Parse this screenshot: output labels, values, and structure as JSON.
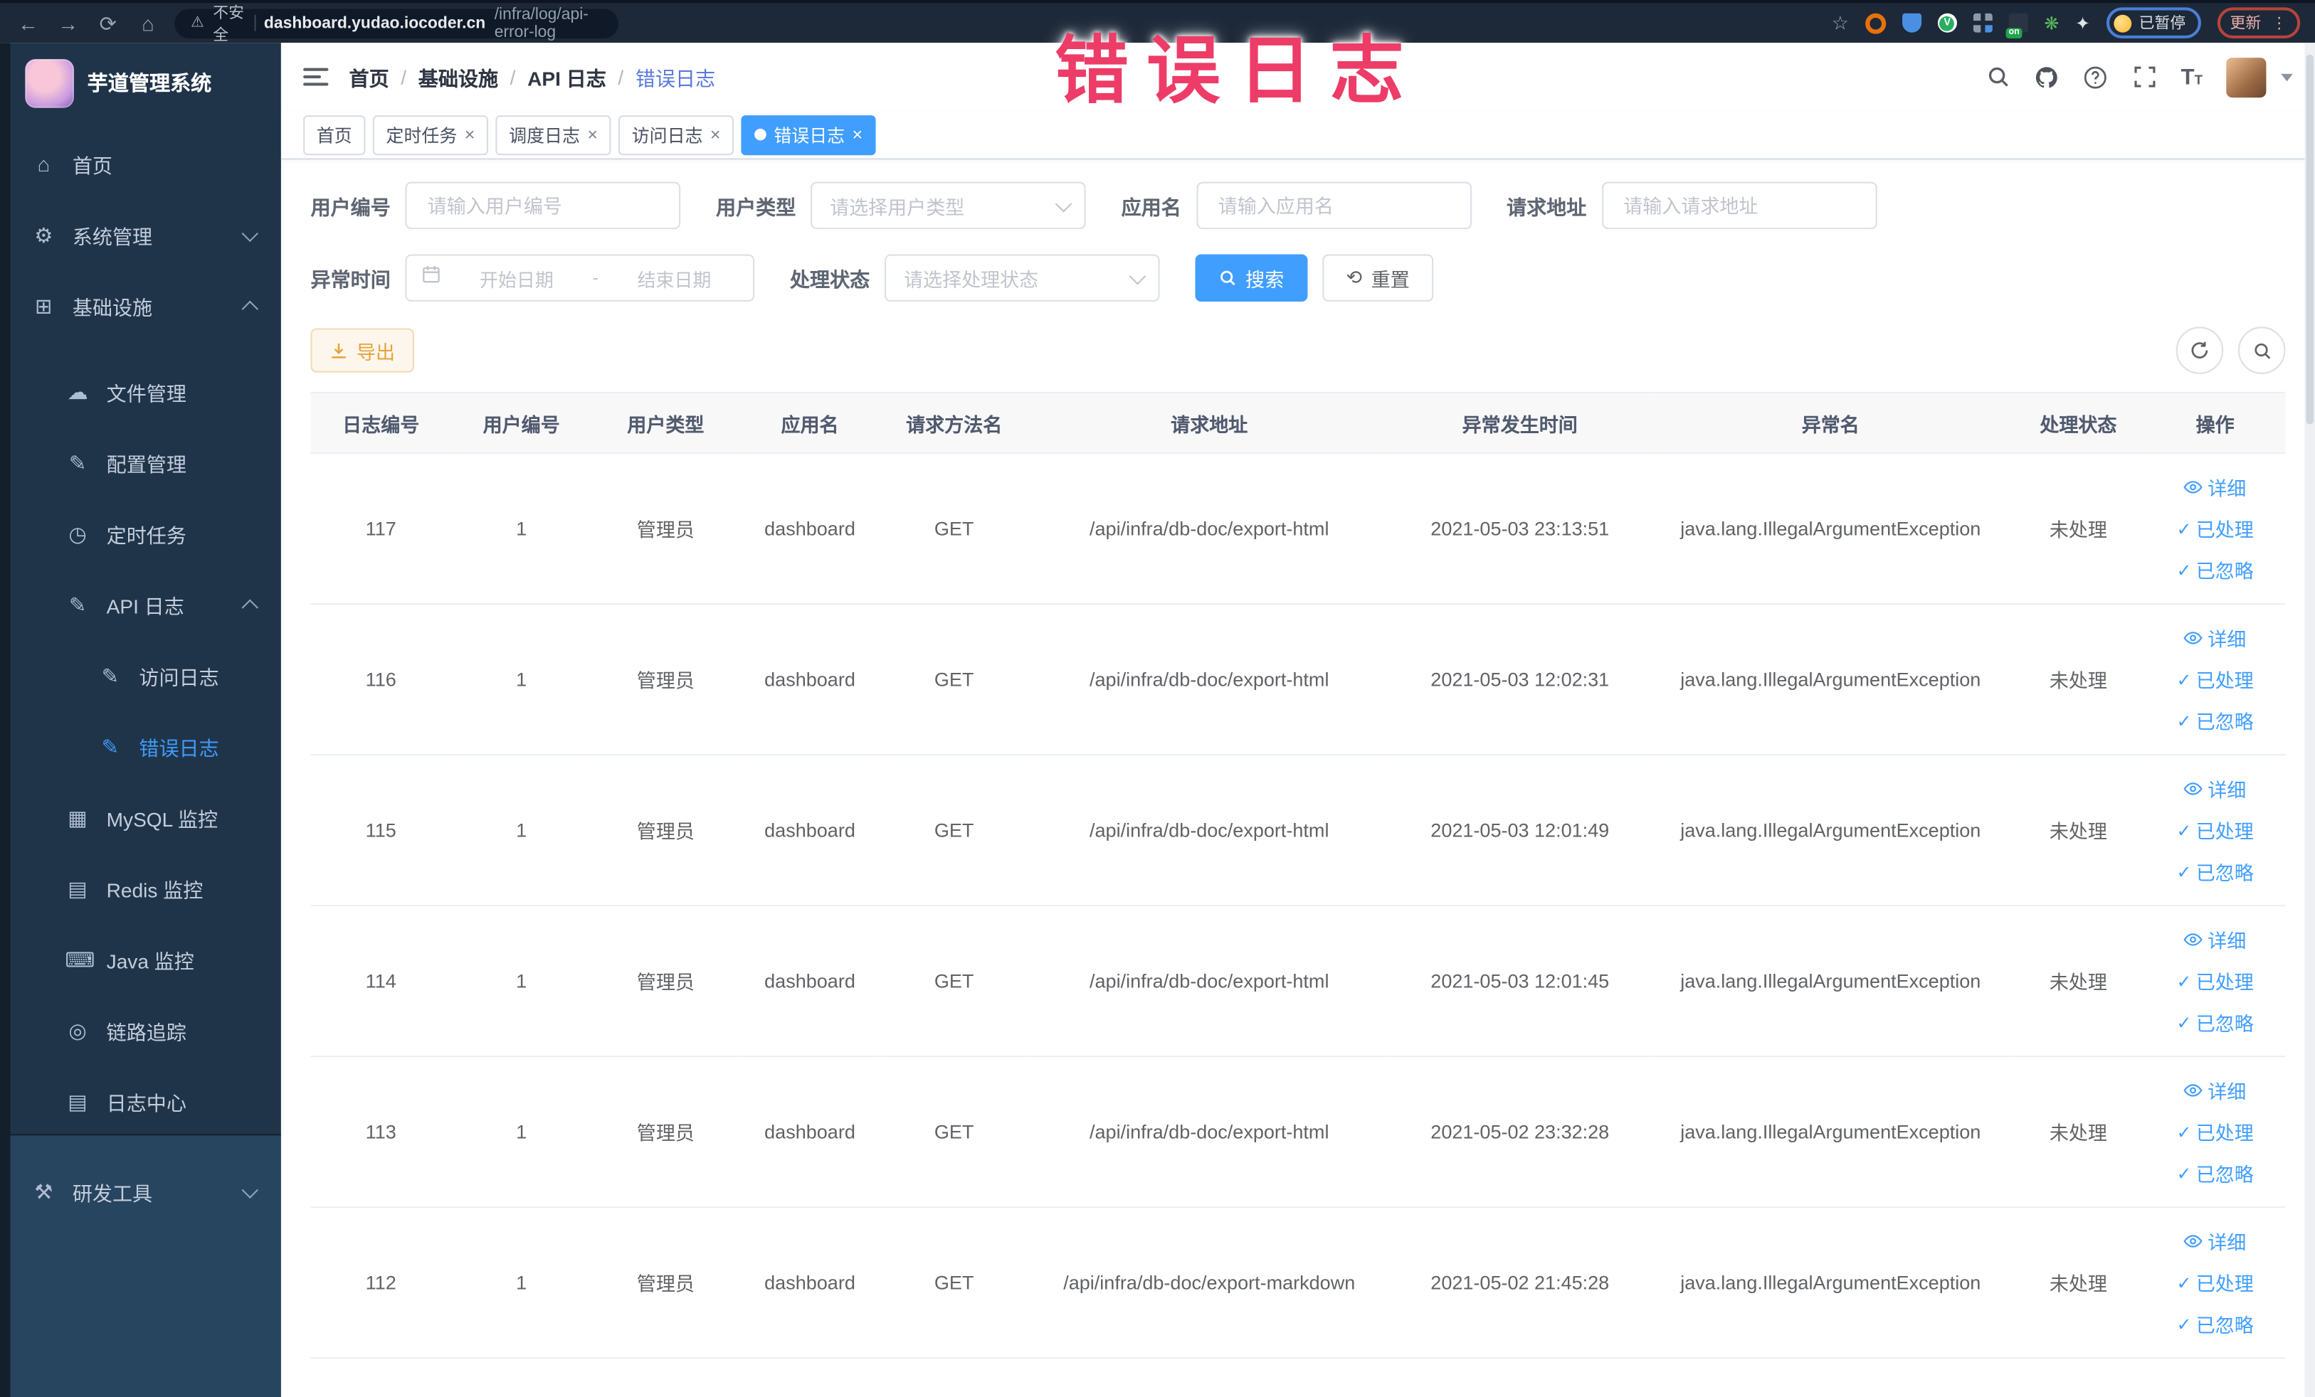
{
  "colors": {
    "accent": "#409eff",
    "warning": "#e6a23c",
    "annotation": "#ed3c68",
    "sidebar_bg": "#203449"
  },
  "icons": {
    "back": "←",
    "forward": "→",
    "reload": "⟳",
    "home": "⌂",
    "warning": "⚠",
    "star": "☆",
    "check": "✓",
    "close": "×",
    "kebab": "⋮",
    "ext_leaf": "❋",
    "ext_puzzle": "✦",
    "ext_green_v": "V",
    "reset": "⟲"
  },
  "annotation": {
    "text": "错误日志"
  },
  "browser": {
    "security_label": "不安全",
    "url_domain": "dashboard.yudao.iocoder.cn",
    "url_path": "/infra/log/api-error-log",
    "ext_on_badge": "on",
    "paused_chip": "已暂停",
    "update_button": "更新"
  },
  "sidebar": {
    "app_title": "芋道管理系统",
    "items": [
      {
        "icon": "⌂",
        "label": "首页"
      },
      {
        "icon": "⚙",
        "label": "系统管理"
      },
      {
        "icon": "⊞",
        "label": "基础设施"
      },
      {
        "icon": "☁",
        "label": "文件管理"
      },
      {
        "icon": "✎",
        "label": "配置管理"
      },
      {
        "icon": "◷",
        "label": "定时任务"
      },
      {
        "icon": "✎",
        "label": "API 日志"
      },
      {
        "icon": "✎",
        "label": "访问日志"
      },
      {
        "icon": "✎",
        "label": "错误日志"
      },
      {
        "icon": "▦",
        "label": "MySQL 监控"
      },
      {
        "icon": "▤",
        "label": "Redis 监控"
      },
      {
        "icon": "⌨",
        "label": "Java 监控"
      },
      {
        "icon": "◎",
        "label": "链路追踪"
      },
      {
        "icon": "▤",
        "label": "日志中心"
      },
      {
        "icon": "⚒",
        "label": "研发工具"
      }
    ]
  },
  "breadcrumb": {
    "separator": "/",
    "items": [
      "首页",
      "基础设施",
      "API 日志",
      "错误日志"
    ]
  },
  "tabs": {
    "items": [
      {
        "label": "首页"
      },
      {
        "label": "定时任务"
      },
      {
        "label": "调度日志"
      },
      {
        "label": "访问日志"
      },
      {
        "label": "错误日志"
      }
    ]
  },
  "filters": {
    "user_id_label": "用户编号",
    "user_id_placeholder": "请输入用户编号",
    "user_type_label": "用户类型",
    "user_type_placeholder": "请选择用户类型",
    "app_label": "应用名",
    "app_placeholder": "请输入应用名",
    "url_label": "请求地址",
    "url_placeholder": "请输入请求地址",
    "time_label": "异常时间",
    "time_start_placeholder": "开始日期",
    "time_separator": "-",
    "time_end_placeholder": "结束日期",
    "status_label": "处理状态",
    "status_placeholder": "请选择处理状态",
    "search_label": "搜索",
    "reset_label": "重置"
  },
  "toolbar": {
    "export_label": "导出"
  },
  "table": {
    "columns": [
      "日志编号",
      "用户编号",
      "用户类型",
      "应用名",
      "请求方法名",
      "请求地址",
      "异常发生时间",
      "异常名",
      "处理状态",
      "操作"
    ],
    "action_labels": {
      "detail": "详细",
      "processed": "已处理",
      "ignored": "已忽略"
    },
    "rows": [
      {
        "id": "117",
        "user_id": "1",
        "user_type": "管理员",
        "app": "dashboard",
        "method": "GET",
        "url": "/api/infra/db-doc/export-html",
        "time": "2021-05-03 23:13:51",
        "exception": "java.lang.IllegalArgumentException",
        "status": "未处理"
      },
      {
        "id": "116",
        "user_id": "1",
        "user_type": "管理员",
        "app": "dashboard",
        "method": "GET",
        "url": "/api/infra/db-doc/export-html",
        "time": "2021-05-03 12:02:31",
        "exception": "java.lang.IllegalArgumentException",
        "status": "未处理"
      },
      {
        "id": "115",
        "user_id": "1",
        "user_type": "管理员",
        "app": "dashboard",
        "method": "GET",
        "url": "/api/infra/db-doc/export-html",
        "time": "2021-05-03 12:01:49",
        "exception": "java.lang.IllegalArgumentException",
        "status": "未处理"
      },
      {
        "id": "114",
        "user_id": "1",
        "user_type": "管理员",
        "app": "dashboard",
        "method": "GET",
        "url": "/api/infra/db-doc/export-html",
        "time": "2021-05-03 12:01:45",
        "exception": "java.lang.IllegalArgumentException",
        "status": "未处理"
      },
      {
        "id": "113",
        "user_id": "1",
        "user_type": "管理员",
        "app": "dashboard",
        "method": "GET",
        "url": "/api/infra/db-doc/export-html",
        "time": "2021-05-02 23:32:28",
        "exception": "java.lang.IllegalArgumentException",
        "status": "未处理"
      },
      {
        "id": "112",
        "user_id": "1",
        "user_type": "管理员",
        "app": "dashboard",
        "method": "GET",
        "url": "/api/infra/db-doc/export-markdown",
        "time": "2021-05-02 21:45:28",
        "exception": "java.lang.IllegalArgumentException",
        "status": "未处理"
      }
    ]
  }
}
